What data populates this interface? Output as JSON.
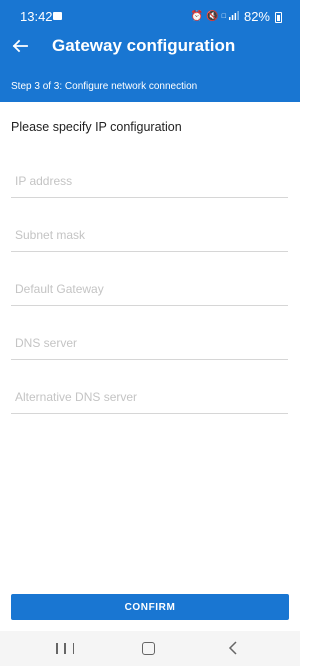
{
  "status_bar": {
    "time": "13:42",
    "battery": "82%",
    "icons": [
      "gallery-icon",
      "alarm-icon",
      "mute-icon",
      "volte-icon",
      "signal-icon",
      "battery-icon"
    ]
  },
  "header": {
    "title": "Gateway configuration",
    "step": "Step 3 of 3: Configure network connection",
    "background_color": "#1976d2"
  },
  "form": {
    "heading": "Please specify IP configuration",
    "fields": [
      {
        "placeholder": "IP address",
        "value": ""
      },
      {
        "placeholder": "Subnet mask",
        "value": ""
      },
      {
        "placeholder": "Default Gateway",
        "value": ""
      },
      {
        "placeholder": "DNS server",
        "value": ""
      },
      {
        "placeholder": "Alternative DNS server",
        "value": ""
      }
    ]
  },
  "actions": {
    "confirm_label": "CONFIRM"
  },
  "nav_bar": {
    "icons": [
      "recents-icon",
      "home-icon",
      "back-icon"
    ]
  }
}
